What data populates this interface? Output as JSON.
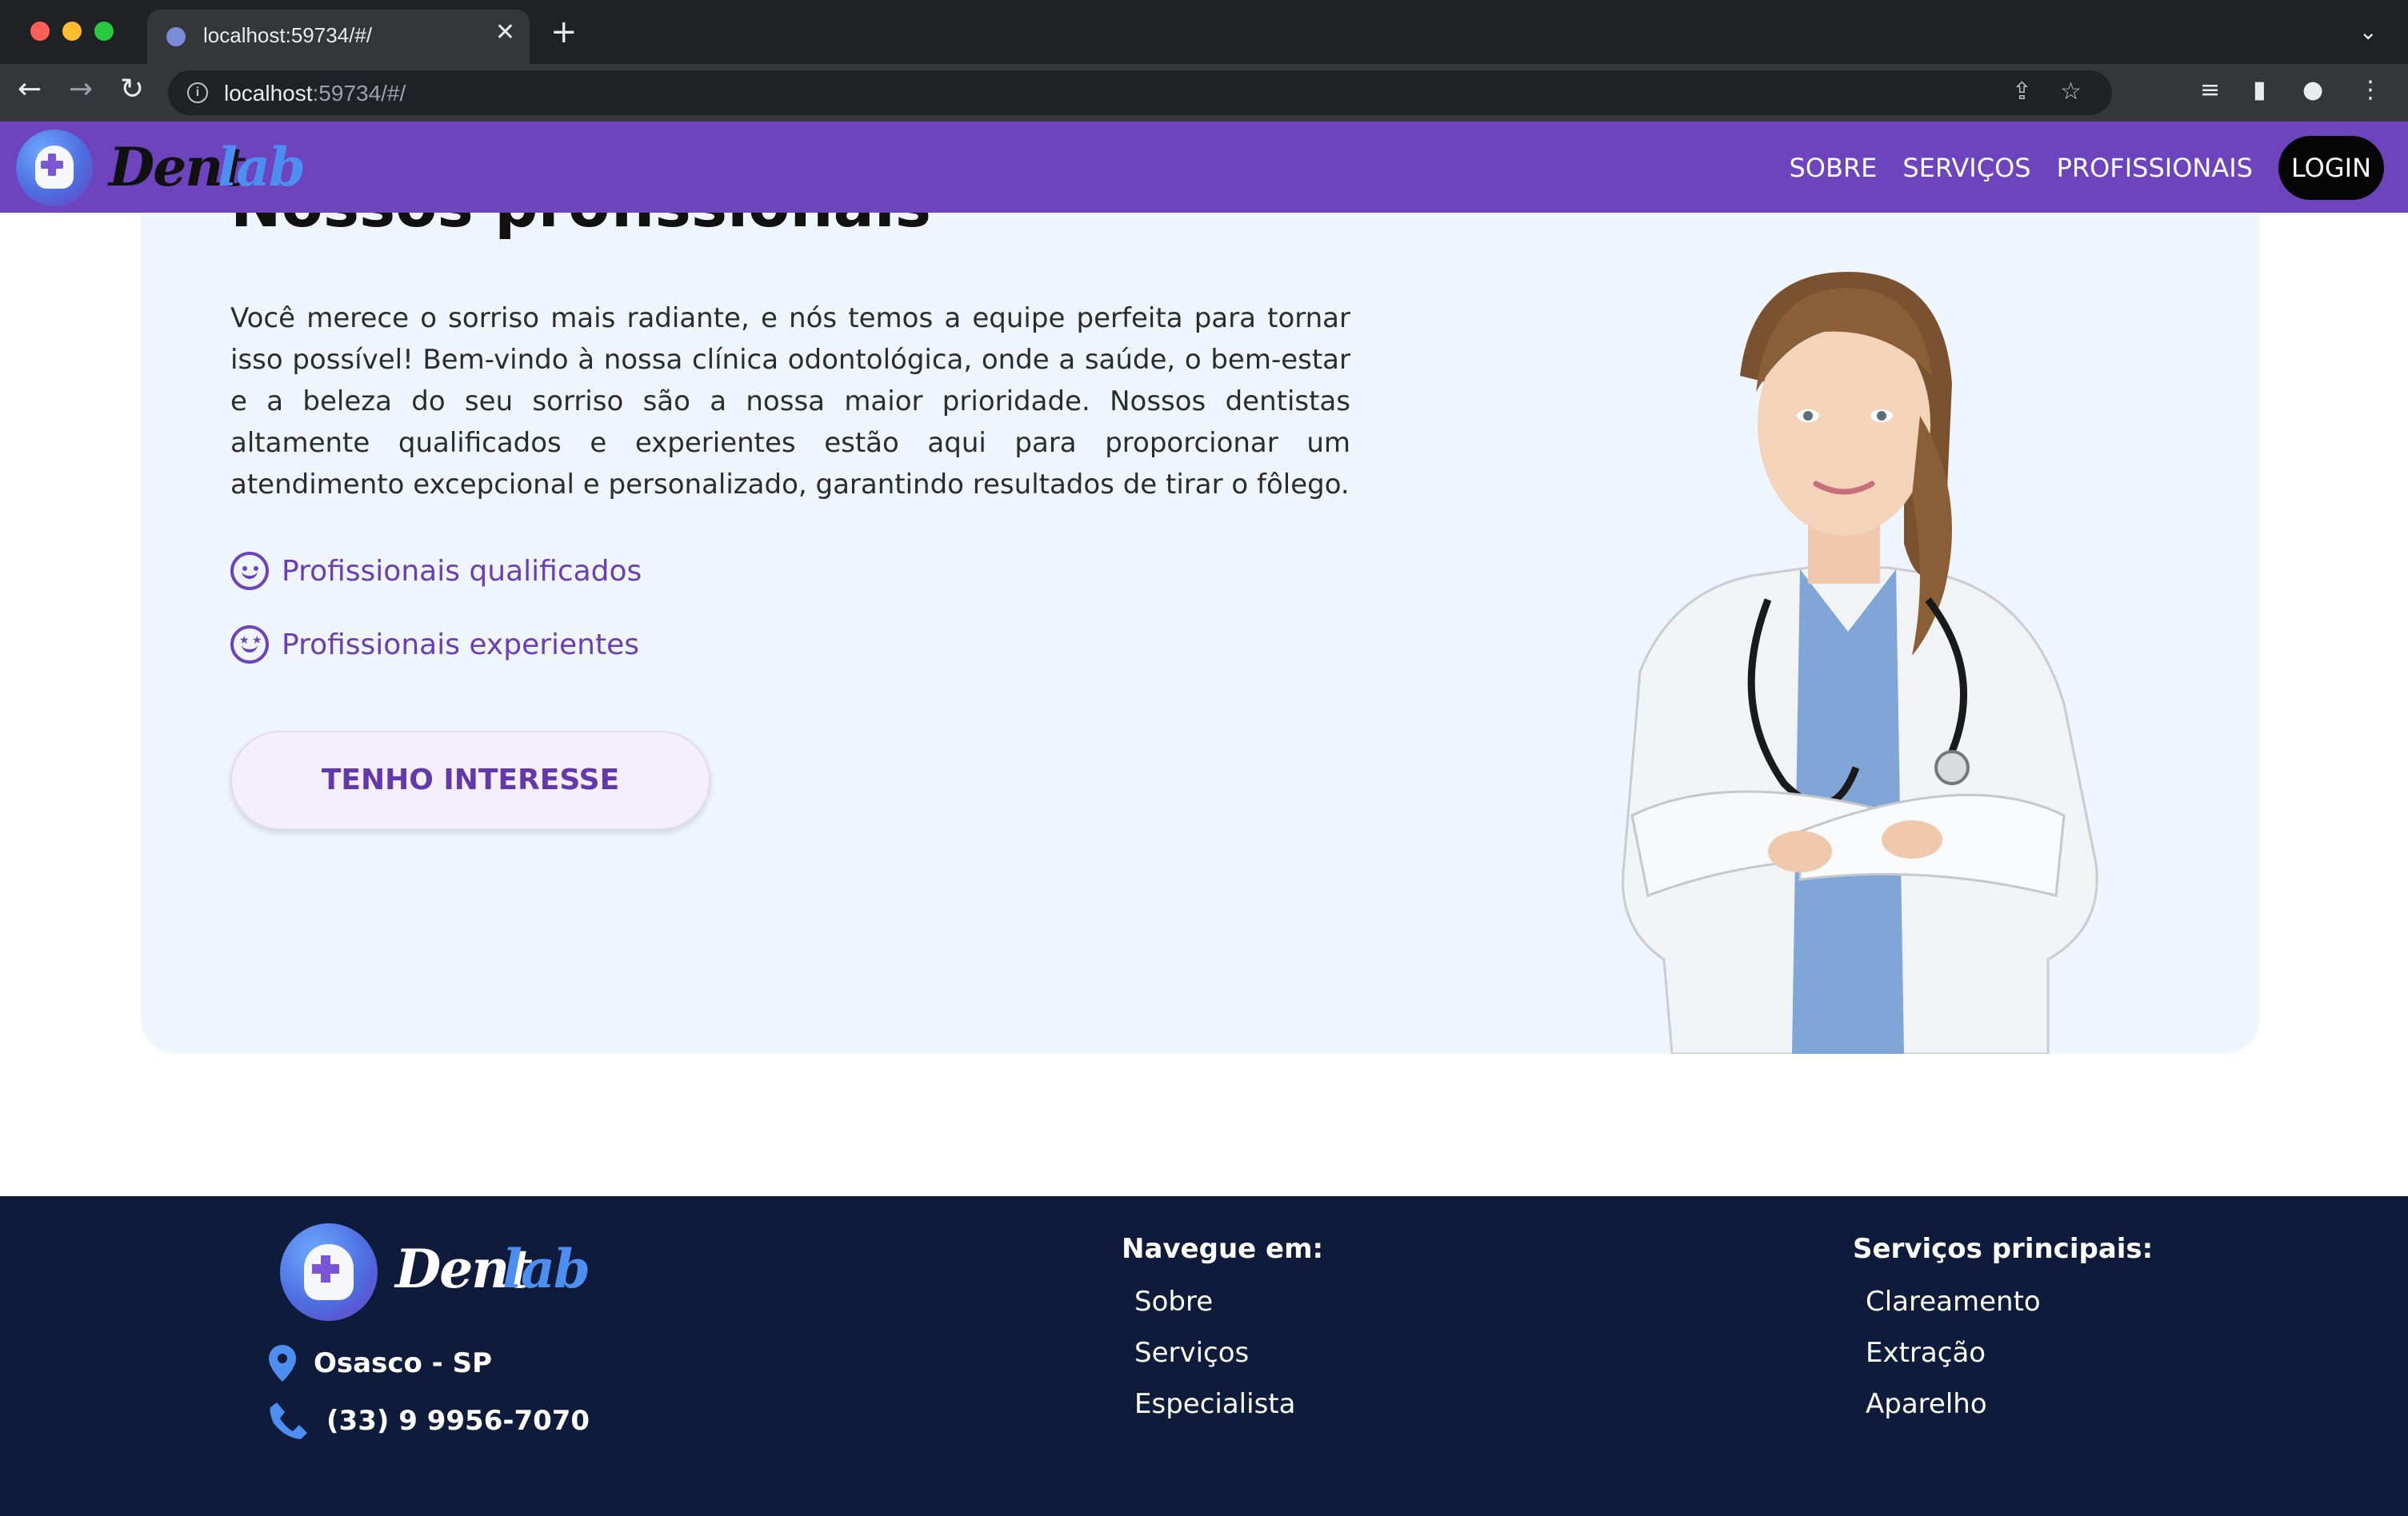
{
  "browser": {
    "tab_title": "localhost:59734/#/",
    "url_host": "localhost",
    "url_rest": ":59734/#/",
    "tab_close": "✕",
    "new_tab": "+"
  },
  "header": {
    "logo_word_1": "Dent",
    "logo_word_2": "lab",
    "nav": {
      "sobre": "SOBRE",
      "servicos": "SERVIÇOS",
      "profissionais": "PROFISSIONAIS",
      "login": "LOGIN"
    },
    "colors": {
      "header_bg": "#6d44bd",
      "login_bg": "#050505"
    }
  },
  "professionals": {
    "title": "Nossos profissionais",
    "text": "Você merece o sorriso mais radiante, e nós temos a equipe perfeita para tornar isso possível! Bem-vindo à nossa clínica odontológica, onde a saúde, o bem-estar e a beleza do seu sorriso são a nossa maior prioridade. Nossos dentistas altamente qualificados e experientes estão aqui para proporcionar um atendimento excepcional e personalizado, garantindo resultados de tirar o fôlego.",
    "features": [
      {
        "icon": "smile-icon",
        "label": "Profissionais qualificados"
      },
      {
        "icon": "star-struck-icon",
        "label": "Profissionais experientes"
      }
    ],
    "cta_label": "TENHO INTERESSE",
    "colors": {
      "accent": "#6d44bd",
      "card_bg": "#eef5fd"
    }
  },
  "footer": {
    "logo_word_1": "Dent",
    "logo_word_2": "lab",
    "city": "Osasco - SP",
    "phone": "(33) 9 9956-7070",
    "navigate": {
      "title": "Navegue em:",
      "links": [
        "Sobre",
        "Serviços",
        "Especialista"
      ]
    },
    "services": {
      "title": "Serviços principais:",
      "links": [
        "Clareamento",
        "Extração",
        "Aparelho"
      ]
    },
    "colors": {
      "footer_bg": "#0e1b3a",
      "icon": "#4d8ff0"
    }
  }
}
